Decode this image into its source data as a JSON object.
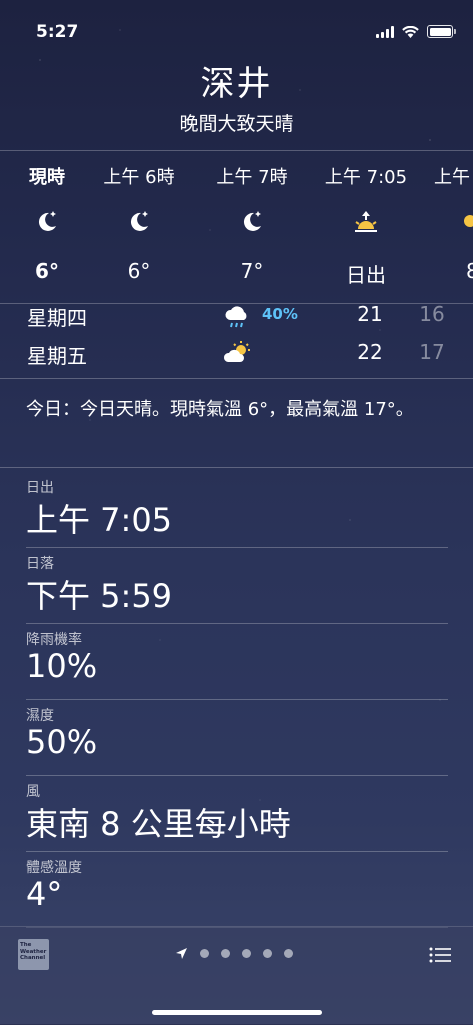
{
  "status": {
    "time": "5:27"
  },
  "location": {
    "city": "深井",
    "condition": "晚間大致天晴"
  },
  "hourly": [
    {
      "label": "現時",
      "icon": "moon-star-icon",
      "value": "6°",
      "bold": true
    },
    {
      "label": "上午 6時",
      "icon": "moon-star-icon",
      "value": "6°"
    },
    {
      "label": "上午 7時",
      "icon": "moon-star-icon",
      "value": "7°"
    },
    {
      "label": "上午 7:05",
      "icon": "sunrise-icon",
      "value": "日出"
    },
    {
      "label": "上午",
      "icon": "sun-icon",
      "value": "8"
    }
  ],
  "daily": [
    {
      "day": "星期四",
      "icon": "rain-cloud-icon",
      "precip": "40%",
      "high": "21",
      "low": "16"
    },
    {
      "day": "星期五",
      "icon": "partly-cloudy-icon",
      "precip": "",
      "high": "22",
      "low": "17"
    }
  ],
  "summary": "今日：今日天晴。現時氣溫 6°，最高氣溫 17°。",
  "details": [
    {
      "key": "日出",
      "value": "上午 7:05"
    },
    {
      "key": "日落",
      "value": "下午 5:59"
    },
    {
      "key": "降雨機率",
      "value": "10%"
    },
    {
      "key": "濕度",
      "value": "50%"
    },
    {
      "key": "風",
      "value": "東南 8 公里每小時"
    },
    {
      "key": "體感溫度",
      "value": "4°"
    }
  ],
  "toolbar": {
    "logo_text": "The Weather Channel",
    "page_count": 5,
    "current_page": 0
  },
  "colors": {
    "precip": "#5ec2f7",
    "sun": "#f6c544"
  }
}
